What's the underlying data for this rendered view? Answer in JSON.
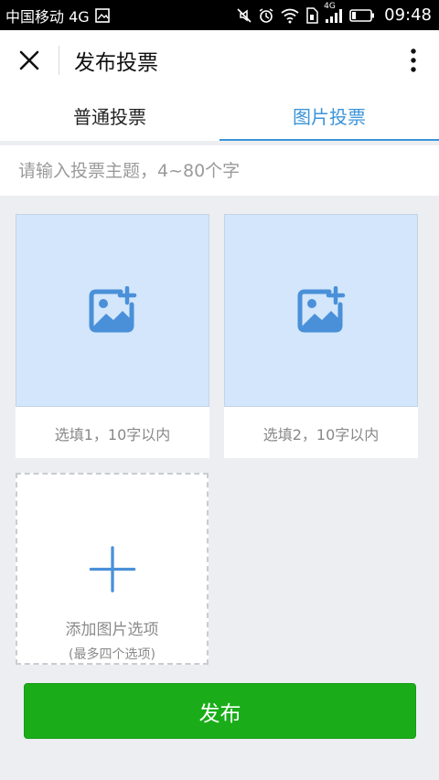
{
  "status_bar": {
    "carrier": "中国移动 4G",
    "network_label": "4G",
    "time": "09:48"
  },
  "header": {
    "title": "发布投票"
  },
  "tabs": [
    {
      "label": "普通投票",
      "active": false
    },
    {
      "label": "图片投票",
      "active": true
    }
  ],
  "topic": {
    "placeholder": "请输入投票主题，4~80个字",
    "value": ""
  },
  "options": [
    {
      "placeholder": "选填1，10字以内"
    },
    {
      "placeholder": "选填2，10字以内"
    }
  ],
  "add_option": {
    "label": "添加图片选项",
    "note": "(最多四个选项)"
  },
  "publish": {
    "label": "发布"
  },
  "colors": {
    "accent_blue": "#3b94d9",
    "publish_green": "#1aad19",
    "image_slot_bg": "#d3e6fb",
    "page_bg": "#eceef2"
  },
  "icons": [
    "close-icon",
    "more-vertical-icon",
    "add-image-icon",
    "plus-icon",
    "mute-icon",
    "alarm-icon",
    "wifi-icon",
    "signal-icon",
    "battery-icon"
  ]
}
